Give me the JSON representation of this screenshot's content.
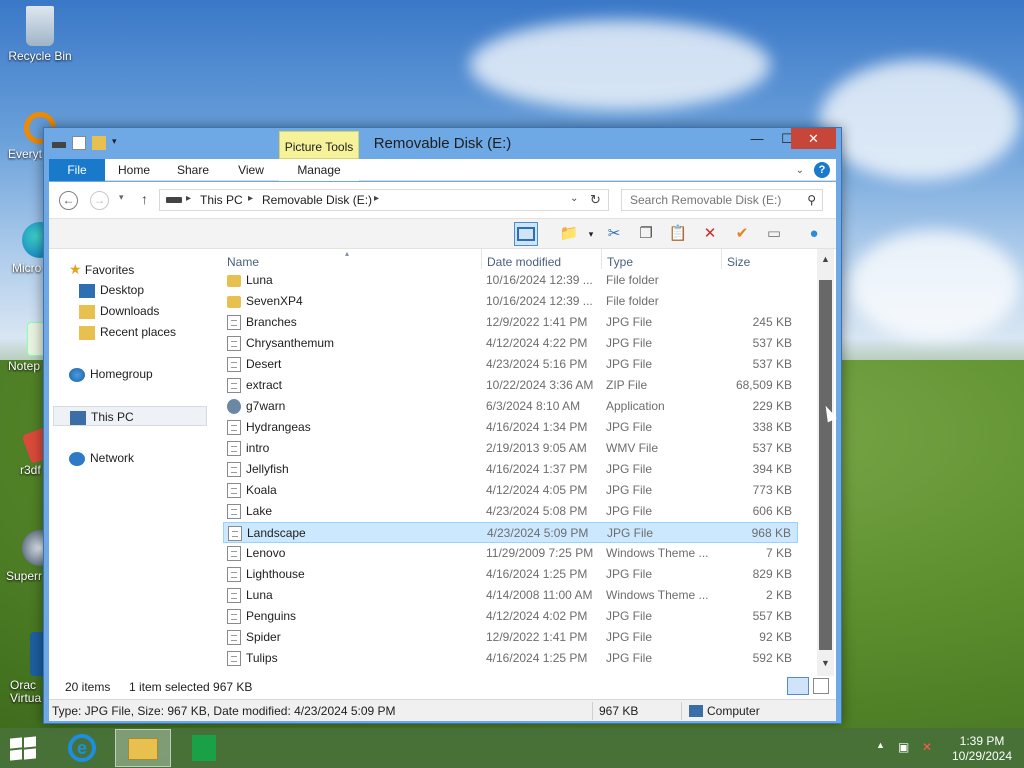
{
  "desktop": {
    "icons": [
      {
        "label": "Recycle Bin",
        "icon": "recycle-bin-icon"
      },
      {
        "label": "Everyt",
        "icon": "everything-search-icon"
      },
      {
        "label": "Micro Ed",
        "icon": "edge-icon"
      },
      {
        "label": "Notep",
        "icon": "notepad-icon"
      },
      {
        "label": "r3df",
        "icon": "app-icon"
      },
      {
        "label": "Superr",
        "icon": "app-icon"
      },
      {
        "label": "Orac Virtua",
        "icon": "virtualbox-icon"
      }
    ]
  },
  "window": {
    "title": "Removable Disk (E:)",
    "context_tab_group": "Picture Tools",
    "tabs": {
      "file": "File",
      "home": "Home",
      "share": "Share",
      "view": "View",
      "manage": "Manage"
    },
    "controls": {
      "minimize": "—",
      "maximize": "☐",
      "close": "✕"
    }
  },
  "address_bar": {
    "crumbs": [
      "This PC",
      "Removable Disk (E:)"
    ],
    "search_placeholder": "Search Removable Disk (E:)"
  },
  "nav_pane": {
    "favorites": "Favorites",
    "desktop": "Desktop",
    "downloads": "Downloads",
    "recent": "Recent places",
    "homegroup": "Homegroup",
    "this_pc": "This PC",
    "network": "Network"
  },
  "columns": {
    "name": "Name",
    "date": "Date modified",
    "type": "Type",
    "size": "Size"
  },
  "files": [
    {
      "name": "Luna",
      "date": "10/16/2024 12:39 ...",
      "type": "File folder",
      "size": "",
      "kind": "folder"
    },
    {
      "name": "SevenXP4",
      "date": "10/16/2024 12:39 ...",
      "type": "File folder",
      "size": "",
      "kind": "folder"
    },
    {
      "name": "Branches",
      "date": "12/9/2022 1:41 PM",
      "type": "JPG File",
      "size": "245 KB",
      "kind": "doc"
    },
    {
      "name": "Chrysanthemum",
      "date": "4/12/2024 4:22 PM",
      "type": "JPG File",
      "size": "537 KB",
      "kind": "doc"
    },
    {
      "name": "Desert",
      "date": "4/23/2024 5:16 PM",
      "type": "JPG File",
      "size": "537 KB",
      "kind": "doc"
    },
    {
      "name": "extract",
      "date": "10/22/2024 3:36 AM",
      "type": "ZIP File",
      "size": "68,509 KB",
      "kind": "doc"
    },
    {
      "name": "g7warn",
      "date": "6/3/2024 8:10 AM",
      "type": "Application",
      "size": "229 KB",
      "kind": "app"
    },
    {
      "name": "Hydrangeas",
      "date": "4/16/2024 1:34 PM",
      "type": "JPG File",
      "size": "338 KB",
      "kind": "doc"
    },
    {
      "name": "intro",
      "date": "2/19/2013 9:05 AM",
      "type": "WMV File",
      "size": "537 KB",
      "kind": "doc"
    },
    {
      "name": "Jellyfish",
      "date": "4/16/2024 1:37 PM",
      "type": "JPG File",
      "size": "394 KB",
      "kind": "doc"
    },
    {
      "name": "Koala",
      "date": "4/12/2024 4:05 PM",
      "type": "JPG File",
      "size": "773 KB",
      "kind": "doc"
    },
    {
      "name": "Lake",
      "date": "4/23/2024 5:08 PM",
      "type": "JPG File",
      "size": "606 KB",
      "kind": "doc"
    },
    {
      "name": "Landscape",
      "date": "4/23/2024 5:09 PM",
      "type": "JPG File",
      "size": "968 KB",
      "kind": "doc",
      "selected": true
    },
    {
      "name": "Lenovo",
      "date": "11/29/2009 7:25 PM",
      "type": "Windows Theme ...",
      "size": "7 KB",
      "kind": "doc"
    },
    {
      "name": "Lighthouse",
      "date": "4/16/2024 1:25 PM",
      "type": "JPG File",
      "size": "829 KB",
      "kind": "doc"
    },
    {
      "name": "Luna",
      "date": "4/14/2008 11:00 AM",
      "type": "Windows Theme ...",
      "size": "2 KB",
      "kind": "doc"
    },
    {
      "name": "Penguins",
      "date": "4/12/2024 4:02 PM",
      "type": "JPG File",
      "size": "557 KB",
      "kind": "doc"
    },
    {
      "name": "Spider",
      "date": "12/9/2022 1:41 PM",
      "type": "JPG File",
      "size": "92 KB",
      "kind": "doc"
    },
    {
      "name": "Tulips",
      "date": "4/16/2024 1:25 PM",
      "type": "JPG File",
      "size": "592 KB",
      "kind": "doc"
    }
  ],
  "status": {
    "item_count": "20 items",
    "selection": "1 item selected  967 KB"
  },
  "infobar": {
    "details": "Type: JPG File, Size: 967 KB, Date modified: 4/23/2024 5:09 PM",
    "size": "967 KB",
    "location": "Computer"
  },
  "taskbar": {
    "time": "1:39 PM",
    "date": "10/29/2024"
  },
  "colors": {
    "accent": "#1979ca",
    "selection": "#cce8ff",
    "close": "#c7463a",
    "picture_tools": "#f6f29a"
  }
}
